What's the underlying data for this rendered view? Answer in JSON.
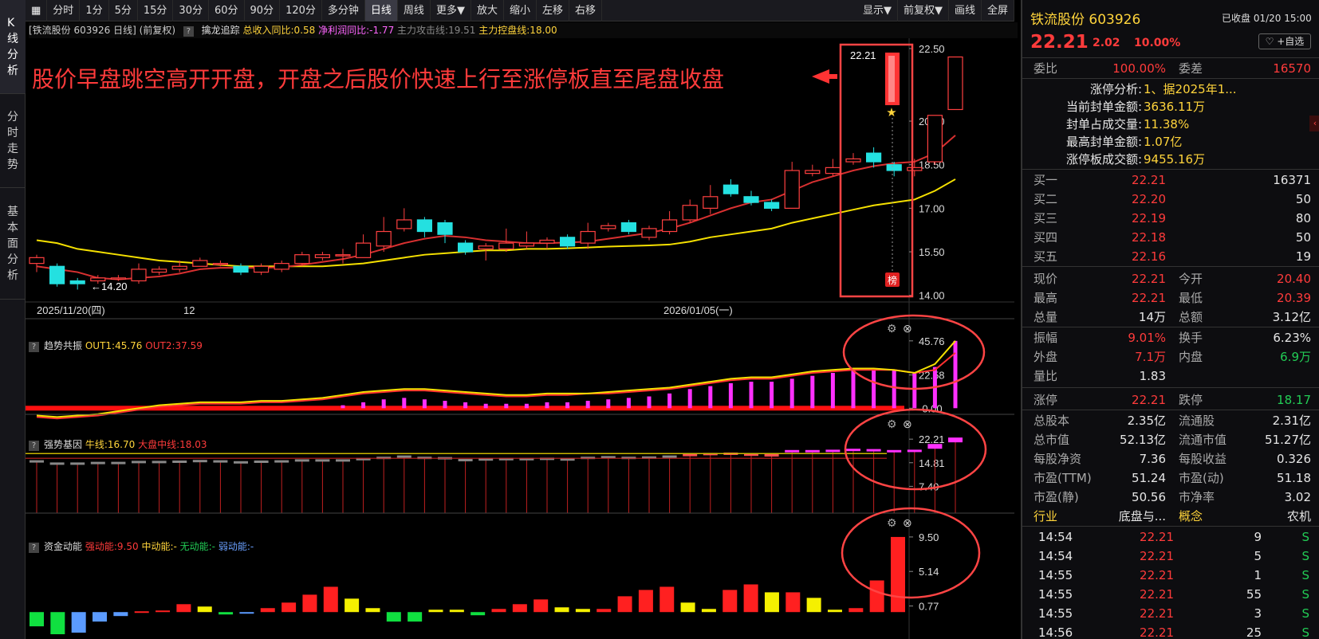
{
  "sidebar": {
    "tabs": [
      "K线分析",
      "分时走势",
      "基本面分析"
    ]
  },
  "toolbar": {
    "left": [
      "分时",
      "1分",
      "5分",
      "15分",
      "30分",
      "60分",
      "90分",
      "120分",
      "多分钟",
      "日线",
      "周线",
      "更多▼",
      "放大",
      "缩小",
      "左移",
      "右移"
    ],
    "right": [
      "显示▼",
      "前复权▼",
      "画线",
      "全屏"
    ],
    "selected": "日线"
  },
  "chart_header": {
    "stock": "[铁流股份 603926 日线]",
    "adjust": "(前复权)",
    "indicator": "擒龙追踪",
    "f1": "总收入同比:0.58",
    "f2": "净利润同比:-1.77",
    "f3": "主力攻击线:19.51",
    "f4": "主力控盘线:18.00"
  },
  "annotation": {
    "text": "股价早盘跳空高开开盘，开盘之后股价快速上行至涨停板直至尾盘收盘",
    "price_tag": "22.21",
    "low_tag": "14.20",
    "badge": "榜"
  },
  "dates": {
    "d1": "2025/11/20(四)",
    "d2": "12",
    "d3": "2026/01/05(一)"
  },
  "panels": {
    "p1": {
      "title": "趋势共振",
      "out1": "OUT1:45.76",
      "out2": "OUT2:37.59"
    },
    "p2": {
      "title": "强势基因",
      "l1": "牛线:16.70",
      "l2": "大盘中线:18.03"
    },
    "p3": {
      "title": "资金动能",
      "l1": "强动能:9.50",
      "l2": "中动能:-",
      "l3": "无动能:-",
      "l4": "弱动能:-"
    }
  },
  "chart_data": [
    {
      "type": "candlestick",
      "title": "铁流股份 603926 日线",
      "y_ticks": [
        "22.50",
        "20.00",
        "18.50",
        "17.00",
        "15.50",
        "14.00"
      ],
      "ylim": [
        13.8,
        22.8
      ],
      "candles": [
        [
          15.1,
          15.3,
          14.8,
          15.4
        ],
        [
          15.0,
          14.4,
          14.3,
          15.1
        ],
        [
          14.5,
          14.4,
          14.2,
          14.6
        ],
        [
          14.5,
          14.6,
          14.4,
          14.7
        ],
        [
          14.6,
          14.6,
          14.5,
          14.7
        ],
        [
          14.5,
          14.9,
          14.4,
          15.1
        ],
        [
          14.8,
          14.9,
          14.7,
          15.0
        ],
        [
          14.9,
          15.0,
          14.8,
          15.2
        ],
        [
          15.0,
          15.2,
          15.0,
          15.3
        ],
        [
          15.1,
          15.1,
          15.0,
          15.2
        ],
        [
          15.0,
          14.8,
          14.7,
          15.1
        ],
        [
          14.8,
          15.0,
          14.7,
          15.1
        ],
        [
          14.9,
          15.1,
          14.8,
          15.2
        ],
        [
          15.1,
          15.4,
          15.0,
          15.5
        ],
        [
          15.3,
          15.4,
          15.2,
          15.5
        ],
        [
          15.4,
          15.4,
          15.1,
          15.6
        ],
        [
          15.3,
          15.8,
          15.3,
          16.1
        ],
        [
          15.7,
          16.2,
          15.5,
          16.7
        ],
        [
          16.3,
          16.6,
          16.2,
          17.0
        ],
        [
          16.6,
          16.2,
          16.0,
          16.7
        ],
        [
          16.5,
          16.1,
          15.8,
          16.6
        ],
        [
          15.8,
          15.5,
          15.4,
          15.9
        ],
        [
          15.6,
          15.7,
          15.2,
          15.8
        ],
        [
          15.6,
          15.8,
          15.5,
          16.3
        ],
        [
          15.7,
          15.8,
          15.6,
          16.2
        ],
        [
          15.8,
          15.9,
          15.6,
          16.0
        ],
        [
          16.0,
          15.7,
          15.6,
          16.1
        ],
        [
          15.8,
          16.2,
          15.6,
          16.5
        ],
        [
          16.3,
          16.4,
          16.2,
          16.5
        ],
        [
          16.5,
          16.2,
          16.1,
          16.6
        ],
        [
          16.0,
          16.3,
          15.9,
          16.4
        ],
        [
          16.2,
          16.6,
          16.1,
          16.9
        ],
        [
          16.6,
          17.1,
          16.5,
          17.3
        ],
        [
          17.0,
          17.4,
          16.8,
          17.8
        ],
        [
          17.8,
          17.5,
          17.4,
          18.0
        ],
        [
          17.4,
          17.2,
          17.1,
          17.6
        ],
        [
          17.2,
          17.0,
          16.9,
          17.3
        ],
        [
          17.0,
          18.3,
          17.0,
          18.6
        ],
        [
          18.2,
          18.3,
          18.1,
          18.5
        ],
        [
          18.2,
          18.4,
          18.1,
          18.7
        ],
        [
          18.6,
          18.7,
          18.5,
          18.9
        ],
        [
          18.9,
          18.6,
          18.4,
          19.1
        ],
        [
          18.5,
          18.3,
          18.1,
          18.6
        ],
        [
          18.3,
          18.4,
          18.1,
          18.7
        ],
        [
          18.6,
          20.2,
          18.5,
          20.2
        ],
        [
          20.4,
          22.21,
          20.39,
          22.21
        ]
      ],
      "ma_yellow": [
        15.9,
        15.8,
        15.6,
        15.5,
        15.4,
        15.3,
        15.2,
        15.15,
        15.1,
        15.05,
        15.0,
        15.0,
        15.0,
        15.0,
        15.0,
        15.05,
        15.1,
        15.2,
        15.3,
        15.4,
        15.45,
        15.5,
        15.55,
        15.55,
        15.6,
        15.6,
        15.62,
        15.65,
        15.68,
        15.7,
        15.72,
        15.75,
        15.85,
        16.0,
        16.1,
        16.2,
        16.3,
        16.5,
        16.65,
        16.8,
        16.95,
        17.1,
        17.2,
        17.3,
        17.6,
        18.0
      ],
      "ma_red": [
        15.0,
        14.9,
        14.8,
        14.6,
        14.55,
        14.6,
        14.65,
        14.75,
        14.9,
        14.95,
        14.95,
        14.95,
        14.97,
        15.05,
        15.15,
        15.25,
        15.4,
        15.6,
        15.8,
        15.95,
        16.05,
        16.0,
        15.9,
        15.85,
        15.8,
        15.8,
        15.82,
        15.85,
        15.95,
        16.05,
        16.15,
        16.3,
        16.5,
        16.75,
        17.0,
        17.2,
        17.3,
        17.6,
        17.9,
        18.1,
        18.3,
        18.45,
        18.55,
        18.6,
        18.9,
        19.51
      ]
    },
    {
      "type": "bar+line",
      "title": "趋势共振",
      "y_ticks": [
        "45.76",
        "22.58",
        "-0.00"
      ],
      "ylim": [
        -2,
        50
      ],
      "bars": [
        0,
        0,
        0,
        0,
        0,
        0,
        0,
        0,
        0,
        0,
        0,
        0,
        0,
        0,
        0,
        2,
        4,
        6,
        7,
        6,
        5,
        4,
        3,
        3,
        3,
        4,
        4,
        5,
        6,
        7,
        8,
        10,
        13,
        15,
        17,
        18,
        18,
        20,
        22,
        24,
        26,
        26,
        26,
        24,
        28,
        45.76
      ],
      "out1": [
        -5,
        -6,
        -5,
        -4,
        -2,
        0,
        2,
        3,
        4,
        4,
        4,
        5,
        5,
        6,
        7,
        9,
        11,
        12,
        13,
        13,
        12,
        11,
        10,
        9,
        9,
        10,
        10,
        10,
        11,
        12,
        13,
        14,
        16,
        18,
        20,
        21,
        21,
        23,
        25,
        26,
        27,
        27,
        26,
        24,
        30,
        45.76
      ],
      "out2": [
        -6,
        -7,
        -6,
        -5,
        -3,
        -1,
        1,
        2,
        3,
        3,
        3,
        4,
        4,
        5,
        6,
        8,
        10,
        11,
        12,
        12,
        11,
        10,
        9,
        8,
        8,
        9,
        9,
        10,
        10,
        11,
        12,
        13,
        15,
        17,
        19,
        20,
        20,
        22,
        24,
        25,
        26,
        26,
        26,
        24,
        26,
        37.59
      ]
    },
    {
      "type": "bar+line",
      "title": "强势基因",
      "y_ticks": [
        "22.21",
        "14.81",
        "7.40"
      ],
      "ylim": [
        0,
        25
      ],
      "bars": [
        15.1,
        14.4,
        14.4,
        14.6,
        14.6,
        14.9,
        14.9,
        15.0,
        15.2,
        15.1,
        14.8,
        15.0,
        15.1,
        15.4,
        15.4,
        15.4,
        15.8,
        16.2,
        16.6,
        16.2,
        16.1,
        15.5,
        15.7,
        15.8,
        15.8,
        15.9,
        15.7,
        16.2,
        16.4,
        16.2,
        16.3,
        16.6,
        17.1,
        17.4,
        17.5,
        17.2,
        17.0,
        18.3,
        18.3,
        18.4,
        18.7,
        18.6,
        18.3,
        18.4,
        20.2,
        22.21
      ],
      "bull": 16.7,
      "market": 18.03
    },
    {
      "type": "bar",
      "title": "资金动能",
      "y_ticks": [
        "9.50",
        "5.14",
        "0.77"
      ],
      "ylim": [
        -3,
        10.5
      ],
      "values": [
        -1.8,
        -2.8,
        -2.6,
        -1.2,
        -0.5,
        0.1,
        0.2,
        1.0,
        0.7,
        -0.3,
        -0.2,
        0.5,
        1.2,
        2.2,
        3.2,
        1.7,
        0.5,
        -1.2,
        -1.2,
        0.3,
        0.3,
        -0.4,
        0.4,
        1.0,
        1.6,
        0.6,
        0.4,
        0.4,
        2.0,
        2.8,
        3.2,
        1.2,
        0.4,
        2.8,
        3.5,
        2.5,
        2.5,
        1.8,
        0.3,
        0.5,
        4.0,
        9.5
      ],
      "colors": [
        "grn",
        "grn",
        "blu",
        "blu",
        "blu",
        "red",
        "red",
        "red",
        "yel",
        "grn",
        "blu",
        "red",
        "red",
        "red",
        "red",
        "yel",
        "yel",
        "grn",
        "grn",
        "yel",
        "yel",
        "grn",
        "red",
        "red",
        "red",
        "yel",
        "yel",
        "red",
        "red",
        "red",
        "red",
        "yel",
        "yel",
        "red",
        "red",
        "yel",
        "red",
        "yel",
        "yel",
        "red",
        "red",
        "red"
      ]
    }
  ],
  "right": {
    "name": "铁流股份 603926",
    "status": "已收盘 01/20 15:00",
    "price": "22.21",
    "chg": "2.02",
    "pct": "10.00%",
    "follow": "♡ +自选",
    "wb_l": "委比",
    "wb": "100.00%",
    "wc_l": "委差",
    "wc": "16570",
    "limit": [
      [
        "涨停分析:",
        "1、据2025年1..."
      ],
      [
        "当前封单金额:",
        "3636.11万"
      ],
      [
        "封单占成交量:",
        "11.38%"
      ],
      [
        "最高封单金额:",
        "1.07亿"
      ],
      [
        "涨停板成交额:",
        "9455.16万"
      ]
    ],
    "bids": [
      [
        "买一",
        "22.21",
        "16371"
      ],
      [
        "买二",
        "22.20",
        "50"
      ],
      [
        "买三",
        "22.19",
        "80"
      ],
      [
        "买四",
        "22.18",
        "50"
      ],
      [
        "买五",
        "22.16",
        "19"
      ]
    ],
    "q1": [
      [
        "现价",
        "22.21",
        "今开",
        "20.40"
      ],
      [
        "最高",
        "22.21",
        "最低",
        "20.39"
      ],
      [
        "总量",
        "14万",
        "总额",
        "3.12亿"
      ]
    ],
    "q2": [
      [
        "振幅",
        "9.01%",
        "换手",
        "6.23%"
      ],
      [
        "外盘",
        "7.1万",
        "内盘",
        "6.9万"
      ],
      [
        "量比",
        "1.83",
        "",
        ""
      ]
    ],
    "zt": [
      "涨停",
      "22.21",
      "跌停",
      "18.17"
    ],
    "q3": [
      [
        "总股本",
        "2.35亿",
        "流通股",
        "2.31亿"
      ],
      [
        "总市值",
        "52.13亿",
        "流通市值",
        "51.27亿"
      ],
      [
        "每股净资",
        "7.36",
        "每股收益",
        "0.326"
      ],
      [
        "市盈(TTM)",
        "51.24",
        "市盈(动)",
        "51.18"
      ],
      [
        "市盈(静)",
        "50.56",
        "市净率",
        "3.02"
      ]
    ],
    "ind": [
      "行业",
      "底盘与...",
      "概念",
      "农机"
    ],
    "ticks": [
      [
        "14:54",
        "22.21",
        "9",
        "S"
      ],
      [
        "14:54",
        "22.21",
        "5",
        "S"
      ],
      [
        "14:55",
        "22.21",
        "1",
        "S"
      ],
      [
        "14:55",
        "22.21",
        "55",
        "S"
      ],
      [
        "14:55",
        "22.21",
        "3",
        "S"
      ],
      [
        "14:56",
        "22.21",
        "25",
        "S"
      ]
    ]
  }
}
